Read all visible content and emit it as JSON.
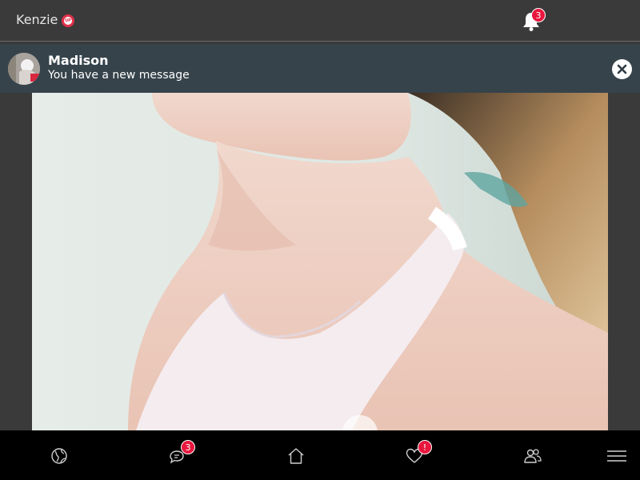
{
  "header": {
    "profile_name": "Kenzie",
    "status_badge_text": "UP",
    "notification_count": "3"
  },
  "notification": {
    "sender": "Madison",
    "message": "You have a new message"
  },
  "bottom_nav": {
    "items": [
      {
        "icon": "globe-icon"
      },
      {
        "icon": "chat-icon",
        "badge": "3"
      },
      {
        "icon": "home-icon"
      },
      {
        "icon": "heart-icon",
        "badge": "!"
      },
      {
        "icon": "people-icon"
      },
      {
        "icon": "menu-icon"
      }
    ]
  },
  "colors": {
    "accent": "#e8173d",
    "topbar": "#3a3a3a",
    "notification_bg": "#36434b",
    "nav_bg": "#000000"
  }
}
